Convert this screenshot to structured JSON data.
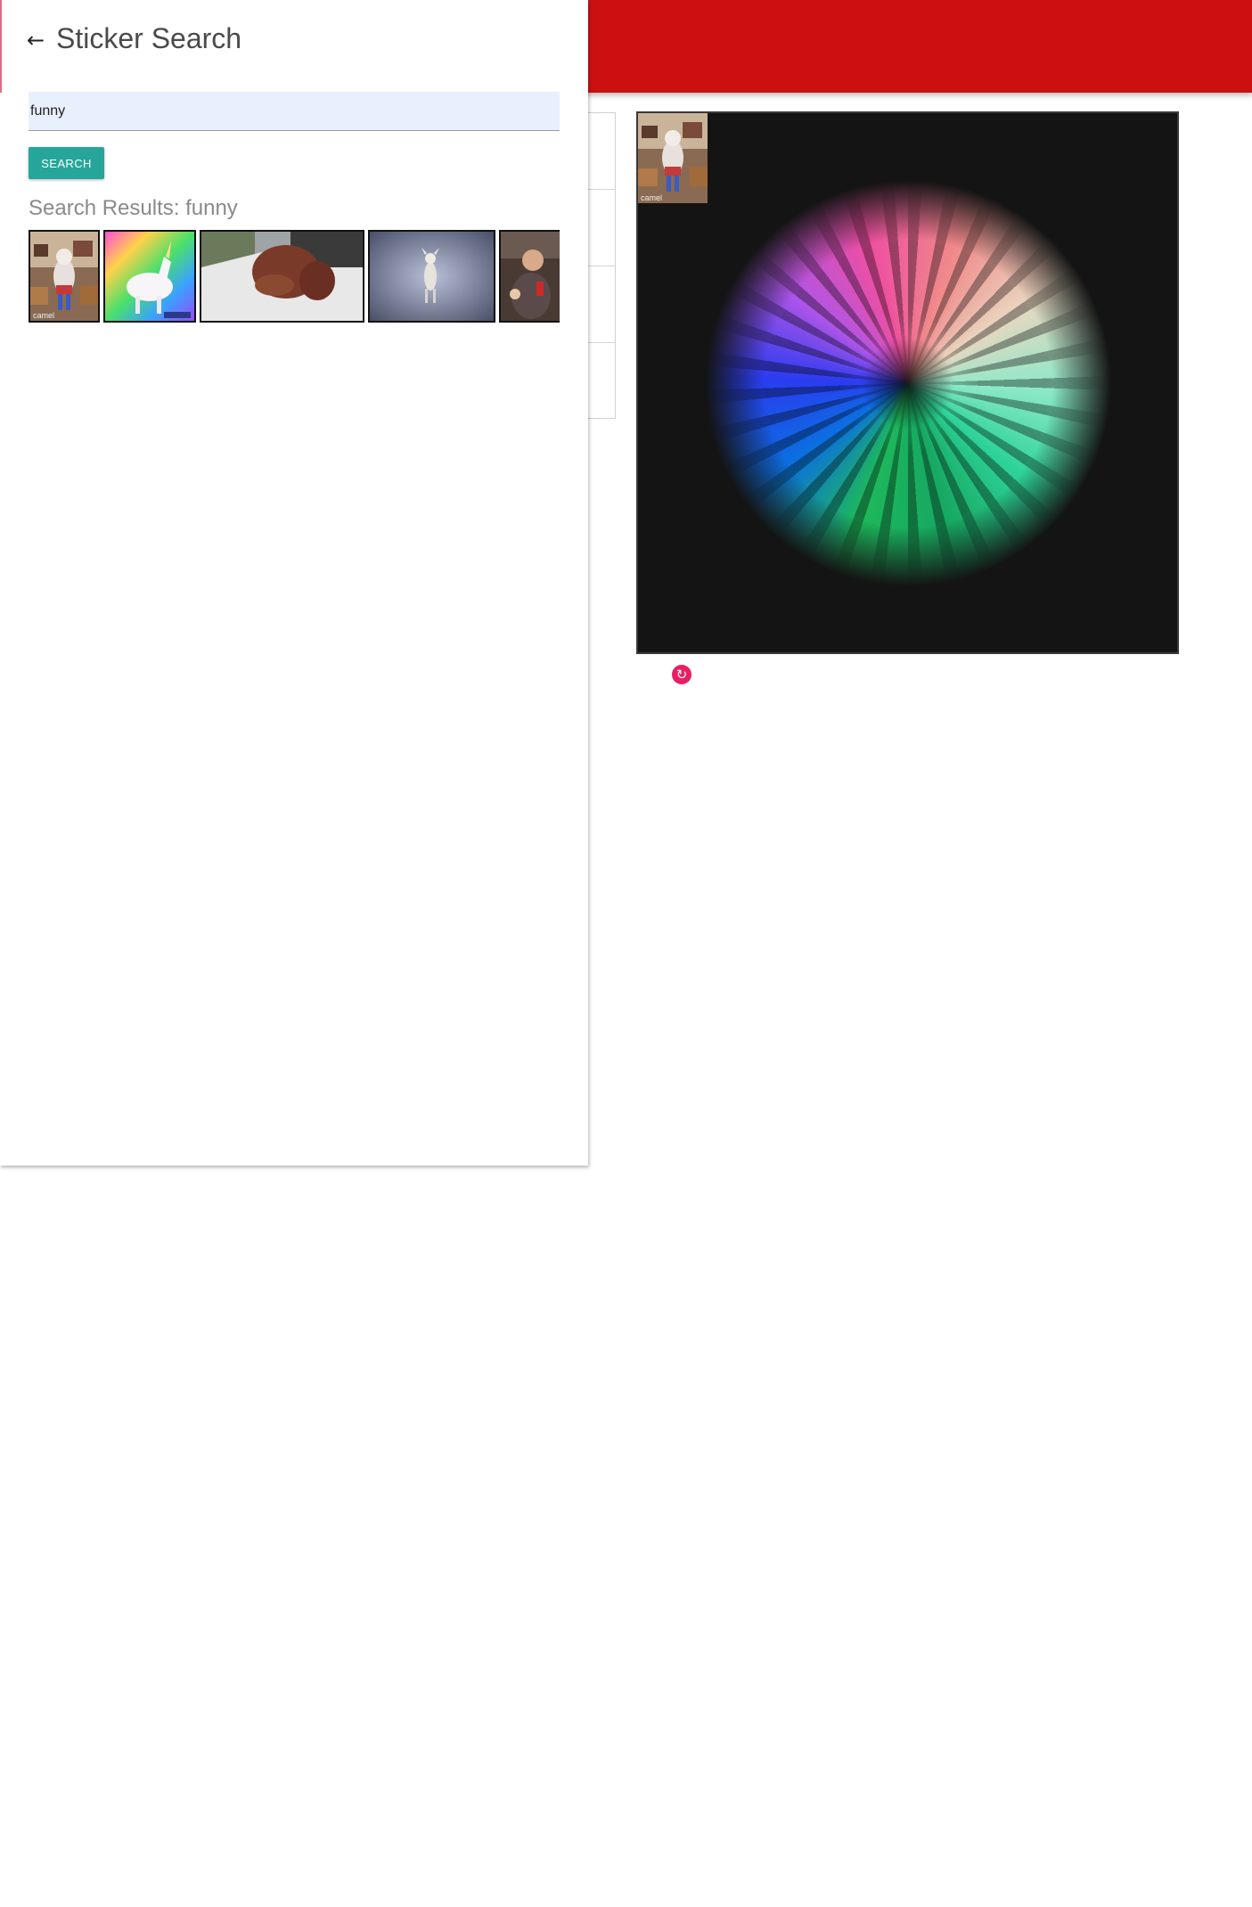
{
  "drawer": {
    "title": "Sticker Search",
    "search": {
      "value": "funny",
      "placeholder": ""
    },
    "search_button": "SEARCH",
    "results_title": "Search Results: funny",
    "results": [
      {
        "name": "result-camel-dog",
        "caption": "camel"
      },
      {
        "name": "result-rainbow-unicorn",
        "caption": ""
      },
      {
        "name": "result-dog-in-car",
        "caption": ""
      },
      {
        "name": "result-dancing-chihuahua",
        "caption": ""
      },
      {
        "name": "result-man-drinking",
        "caption": ""
      }
    ]
  },
  "canvas": {
    "placed_sticker_caption": "camel"
  },
  "colors": {
    "topbar": "#cc1010",
    "search_button": "#26a69a",
    "refresh_button": "#e91e63",
    "input_background": "#e8f0fe"
  },
  "icons": {
    "back": "arrow-left-icon",
    "refresh": "refresh-icon"
  }
}
